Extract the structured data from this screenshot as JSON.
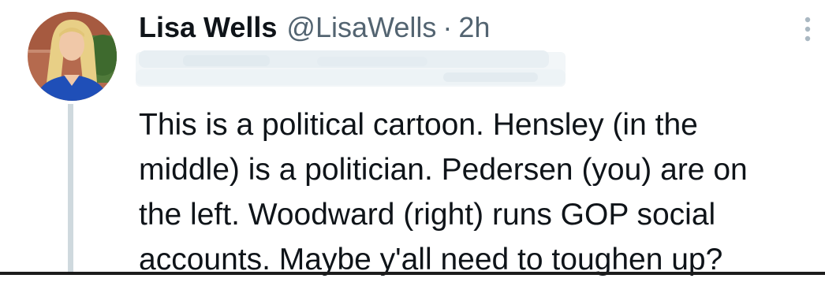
{
  "tweet": {
    "author_name": "Lisa Wells",
    "handle": "@LisaWells",
    "separator": "·",
    "timestamp": "2h",
    "body": "This is a political cartoon. Hensley (in the\nmiddle) is a politician. Pedersen (you) are on\nthe left. Woodward (right) runs GOP social\naccounts. Maybe y'all need to toughen up?",
    "more_icon": "vertical-ellipsis-icon",
    "avatar_icon": "profile-photo"
  },
  "colors": {
    "text_primary": "#0f1419",
    "text_secondary": "#536471",
    "thread_line": "#cfd9de",
    "background": "#ffffff"
  }
}
